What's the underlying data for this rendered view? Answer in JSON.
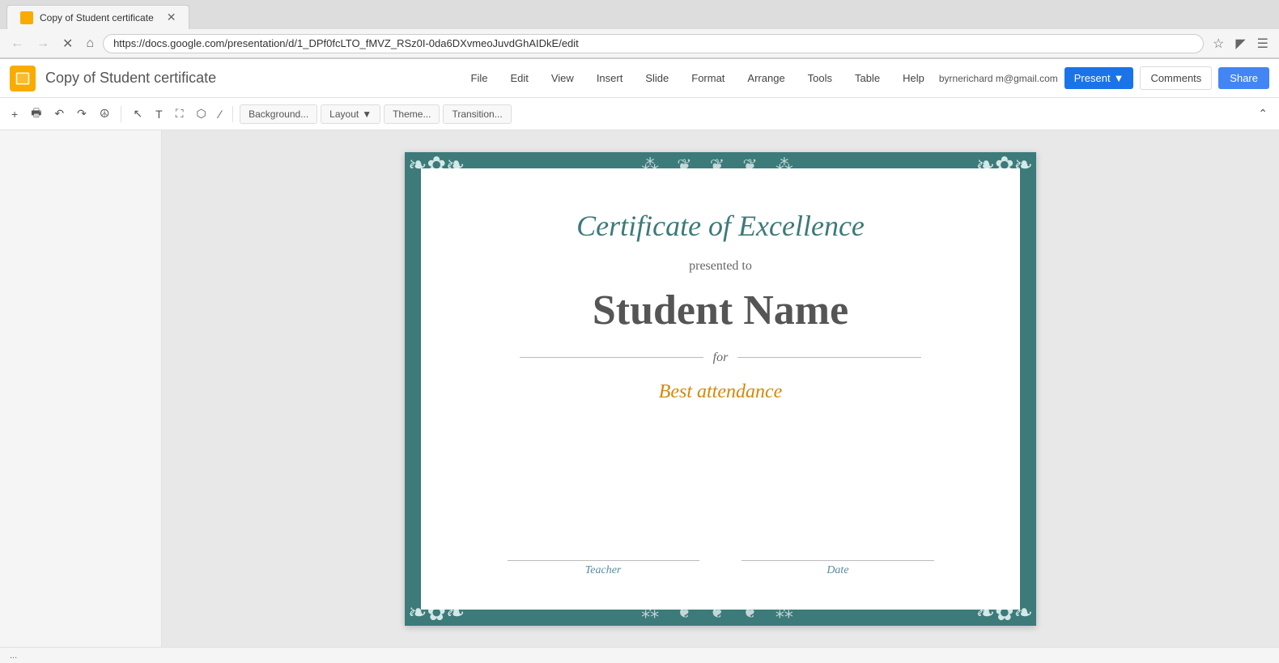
{
  "browser": {
    "url": "https://docs.google.com/presentation/d/1_DPf0fcLTO_fMVZ_RSz0I-0da6DXvmeoJuvdGhAIDkE/edit",
    "tab_title": "Copy of Student certificate",
    "favicon_color": "#f9ab00"
  },
  "app": {
    "title": "Copy of Student certificate",
    "user_email": "byrnerichard m@gmail.com",
    "menu": {
      "items": [
        "File",
        "Edit",
        "View",
        "Insert",
        "Slide",
        "Format",
        "Arrange",
        "Tools",
        "Table",
        "Help"
      ]
    },
    "header_buttons": {
      "present": "Present",
      "comments": "Comments",
      "share": "Share"
    }
  },
  "toolbar": {
    "background_btn": "Background...",
    "layout_btn": "Layout",
    "theme_btn": "Theme...",
    "transition_btn": "Transition..."
  },
  "certificate": {
    "title": "Certificate of Excellence",
    "presented_to": "presented to",
    "student_name": "Student Name",
    "for_label": "for",
    "achievement": "Best attendance",
    "teacher_label": "Teacher",
    "date_label": "Date"
  },
  "status": {
    "text": "..."
  }
}
